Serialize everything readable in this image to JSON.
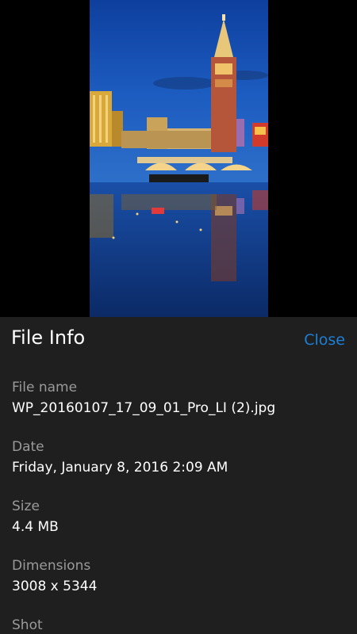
{
  "photo": {
    "subject": "night-cityscape-photo"
  },
  "panel": {
    "title": "File Info",
    "close_label": "Close",
    "fields": [
      {
        "label": "File name",
        "value": "WP_20160107_17_09_01_Pro_LI (2).jpg"
      },
      {
        "label": "Date",
        "value": "Friday, January 8, 2016 2:09 AM"
      },
      {
        "label": "Size",
        "value": "4.4 MB"
      },
      {
        "label": "Dimensions",
        "value": "3008 x 5344"
      },
      {
        "label": "Shot",
        "value": ""
      }
    ]
  },
  "colors": {
    "background": "#000000",
    "panel": "#1f1f1f",
    "accent": "#1e7fd6",
    "label": "#9a9a9a",
    "text": "#ffffff"
  }
}
